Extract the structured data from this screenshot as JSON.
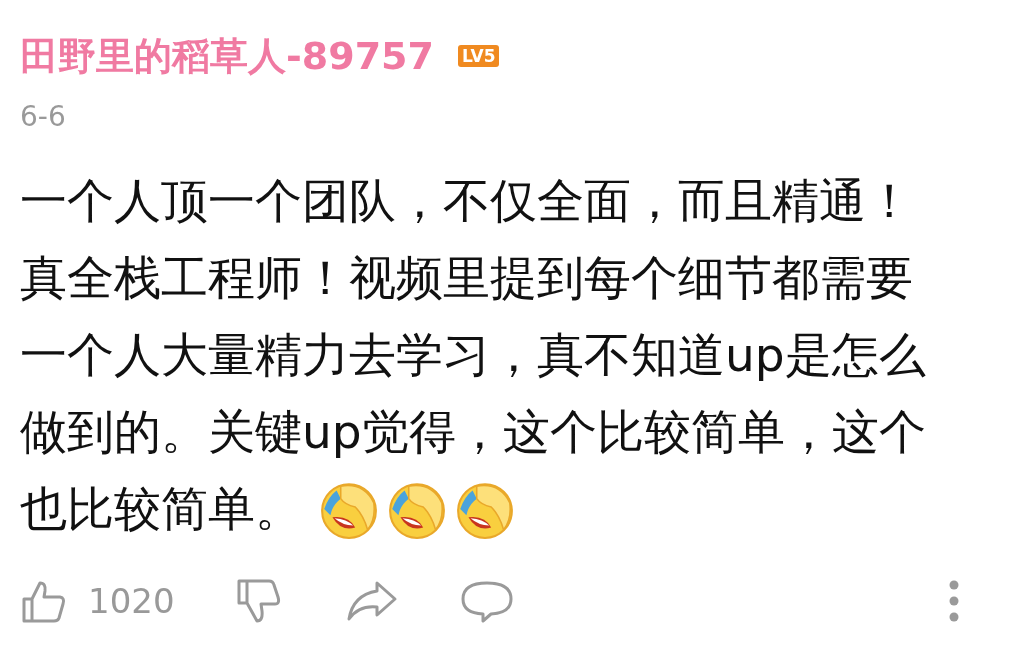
{
  "comment": {
    "username": "田野里的稻草人-89757",
    "level_badge": "LV5",
    "date": "6-6",
    "text_lines": [
      "一个人顶一个团队，不仅全面，而且精通！",
      "真全栈工程师！视频里提到每个细节都需要",
      "一个人大量精力去学习，真不知道up是怎么",
      "做到的。关键up觉得，这个比较简单，这个",
      "也比较简单。"
    ],
    "emojis": [
      {
        "kind": "facepalm-laugh"
      },
      {
        "kind": "facepalm-laugh"
      },
      {
        "kind": "facepalm-laugh"
      }
    ],
    "like_count": "1020"
  }
}
